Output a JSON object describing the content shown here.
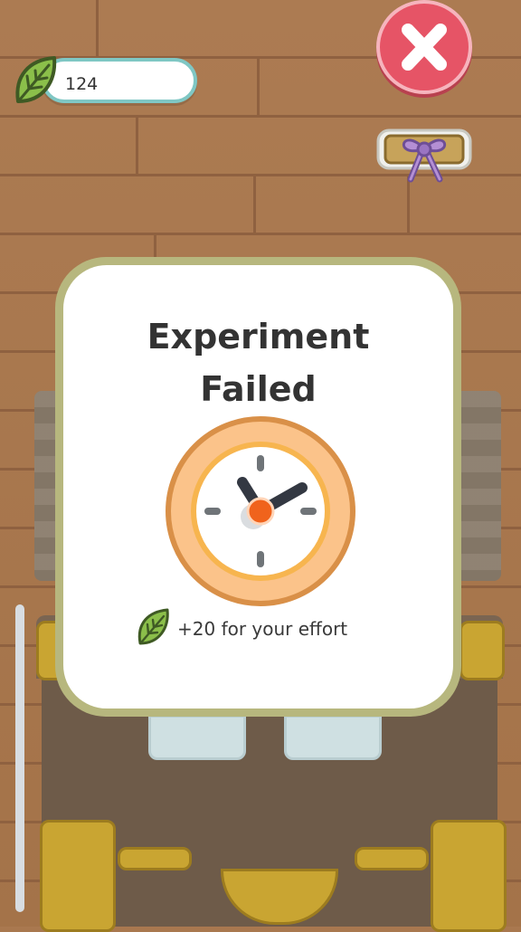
{
  "hud": {
    "leaf_count": "124",
    "leaf_icon": "leaf-icon",
    "close_icon": "close-icon",
    "gift_icon": "gift-bow-icon"
  },
  "modal": {
    "title_line1": "Experiment",
    "title_line2": "Failed",
    "clock_icon": "clock-icon",
    "reward_icon": "leaf-icon",
    "reward_text": "+20 for your effort"
  },
  "colors": {
    "close": "#e65466",
    "counter_border": "#7fc7c4",
    "modal_border": "#b7b77e",
    "clock_ring": "#f4a15a",
    "clock_center": "#f0631c"
  }
}
